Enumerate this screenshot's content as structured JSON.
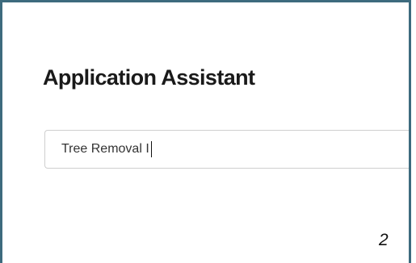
{
  "header": {
    "title": "Application Assistant"
  },
  "search": {
    "value": "Tree Removal I"
  },
  "annotation": {
    "step": "2"
  }
}
